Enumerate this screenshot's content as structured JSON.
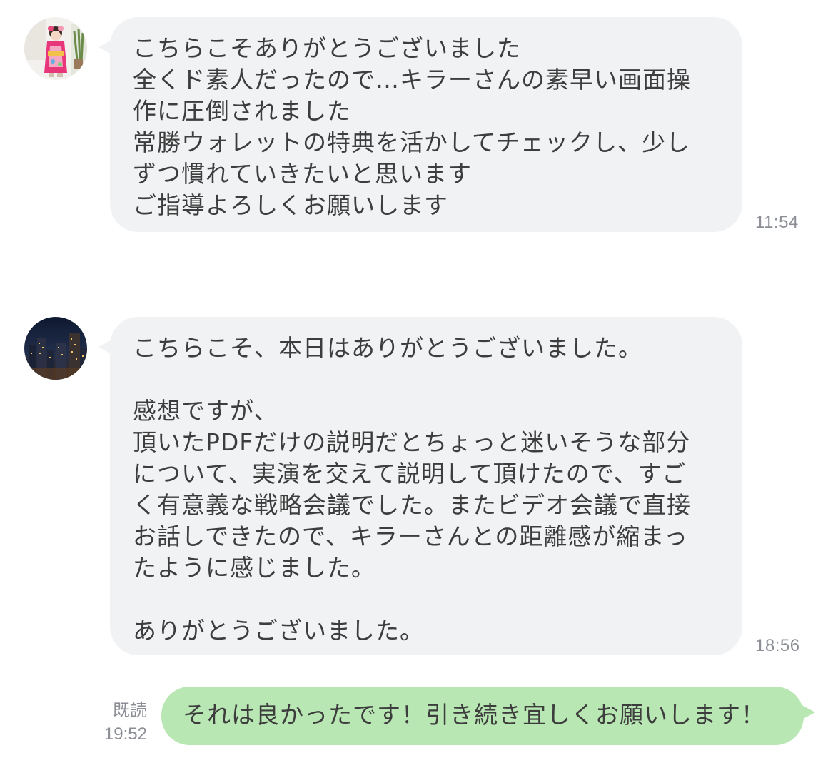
{
  "messages": [
    {
      "direction": "incoming",
      "avatar_icon": "kimono-girl-avatar",
      "text": "こちらこそありがとうございました\n全くド素人だったので…キラーさんの素早い画面操\n作に圧倒されました\n常勝ウォレットの特典を活かしてチェックし、少し\nずつ慣れていきたいと思います\nご指導よろしくお願いします",
      "time": "11:54"
    },
    {
      "direction": "incoming",
      "avatar_icon": "night-city-avatar",
      "text": "こちらこそ、本日はありがとうございました。\n\n感想ですが、\n頂いたPDFだけの説明だとちょっと迷いそうな部分\nについて、実演を交えて説明して頂けたので、すご\nく有意義な戦略会議でした。またビデオ会議で直接\nお話しできたので、キラーさんとの距離感が縮まっ\nたように感じました。\n\nありがとうございました。",
      "time": "18:56"
    },
    {
      "direction": "outgoing",
      "text": "それは良かったです！引き続き宜しくお願いします！",
      "read_label": "既読",
      "time": "19:52"
    }
  ],
  "colors": {
    "incoming_bubble": "#f1f2f4",
    "outgoing_bubble": "#b9e7b4",
    "meta_text": "#8b8f95",
    "message_text": "#3d3d3d"
  }
}
